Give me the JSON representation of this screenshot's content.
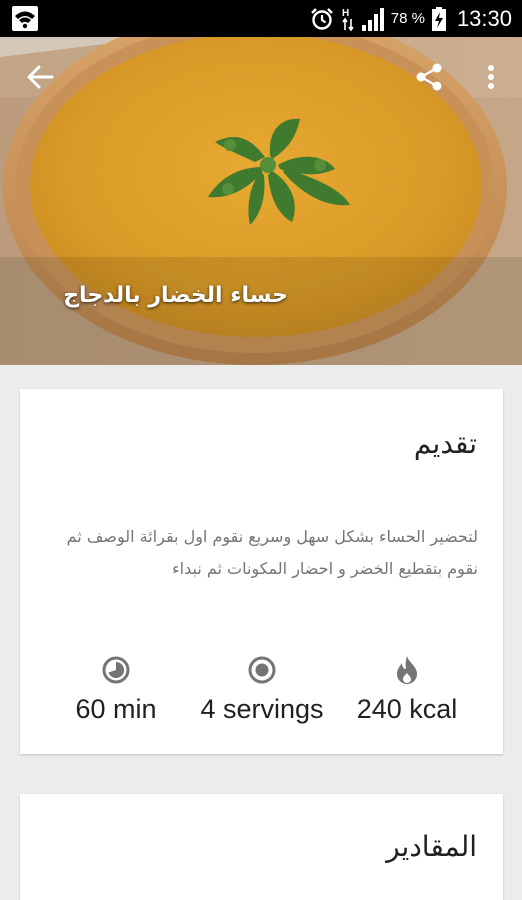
{
  "status_bar": {
    "battery_percent": "78 %",
    "time": "13:30"
  },
  "hero": {
    "title": "حساء الخضار بالدجاج",
    "back_icon": "arrow-back-icon",
    "share_icon": "share-icon",
    "more_icon": "more-vert-icon"
  },
  "intro_card": {
    "title": "تقديم",
    "description": "لتحضير الحساء  بشكل سهل وسريع نقوم اول بقرائة الوصف ثم نقوم بتقطيع الخضر و احضار المكونات ثم نبداء",
    "stats": {
      "time": "60 min",
      "servings": "4 servings",
      "calories": "240 kcal"
    }
  },
  "ingredients_card": {
    "title": "المقادير"
  },
  "colors": {
    "status_bar": "#000000",
    "background": "#ececec",
    "card": "#ffffff",
    "icon_gray": "#757575",
    "text_dark": "#212121"
  }
}
